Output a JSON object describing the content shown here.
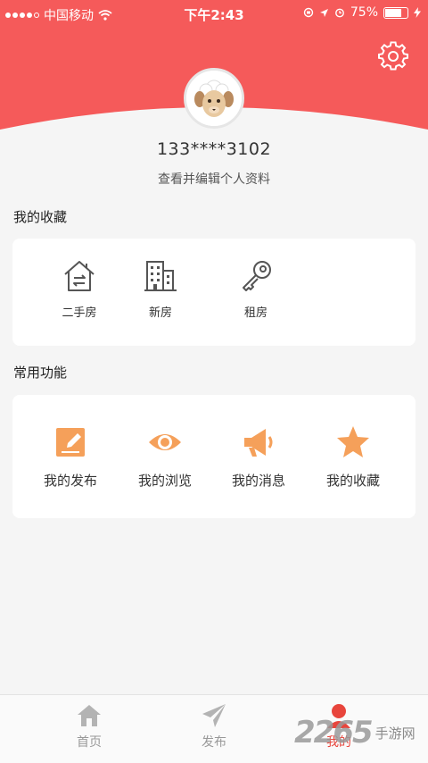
{
  "status_bar": {
    "carrier": "中国移动",
    "time": "下午2:43",
    "battery": "75%",
    "battery_level": 0.75
  },
  "profile": {
    "phone": "133****3102",
    "edit_link": "查看并编辑个人资料"
  },
  "favorites": {
    "title": "我的收藏",
    "items": [
      {
        "label": "二手房",
        "icon": "house-exchange-icon"
      },
      {
        "label": "新房",
        "icon": "building-icon"
      },
      {
        "label": "租房",
        "icon": "key-icon"
      }
    ]
  },
  "functions": {
    "title": "常用功能",
    "items": [
      {
        "label": "我的发布",
        "icon": "edit-icon"
      },
      {
        "label": "我的浏览",
        "icon": "eye-icon"
      },
      {
        "label": "我的消息",
        "icon": "megaphone-icon"
      },
      {
        "label": "我的收藏",
        "icon": "star-icon"
      }
    ]
  },
  "tabbar": {
    "tabs": [
      {
        "label": "首页",
        "icon": "home-icon"
      },
      {
        "label": "发布",
        "icon": "paper-plane-icon"
      },
      {
        "label": "我的",
        "icon": "user-icon",
        "active": true
      }
    ]
  },
  "watermark": {
    "logo": "2265",
    "text": "手游网"
  },
  "colors": {
    "header": "#f55a5a",
    "accent_orange": "#f5a05a",
    "active_tab": "#e8453c"
  }
}
